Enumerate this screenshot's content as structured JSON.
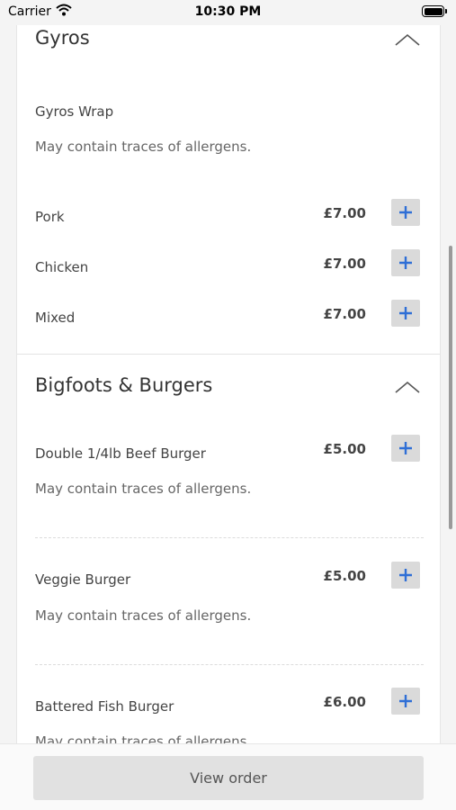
{
  "status_bar": {
    "carrier": "Carrier",
    "time": "10:30 PM"
  },
  "sections": [
    {
      "title": "Gyros",
      "group_title": "Gyros Wrap",
      "group_desc": "May contain traces of allergens.",
      "items": [
        {
          "name": "Pork",
          "price": "£7.00"
        },
        {
          "name": "Chicken",
          "price": "£7.00"
        },
        {
          "name": "Mixed",
          "price": "£7.00"
        }
      ]
    },
    {
      "title": "Bigfoots & Burgers",
      "items": [
        {
          "name": "Double 1/4lb Beef Burger",
          "price": "£5.00",
          "desc": "May contain traces of allergens."
        },
        {
          "name": "Veggie Burger",
          "price": "£5.00",
          "desc": "May contain traces of allergens."
        },
        {
          "name": "Battered Fish Burger",
          "price": "£6.00",
          "desc": "May contain traces of allergens."
        }
      ]
    }
  ],
  "footer": {
    "view_order_label": "View order"
  },
  "colors": {
    "accent_plus": "#2f6fd6",
    "button_bg": "#dadada"
  },
  "icons": {
    "collapse": "chevron-up-icon",
    "add": "plus-icon"
  }
}
